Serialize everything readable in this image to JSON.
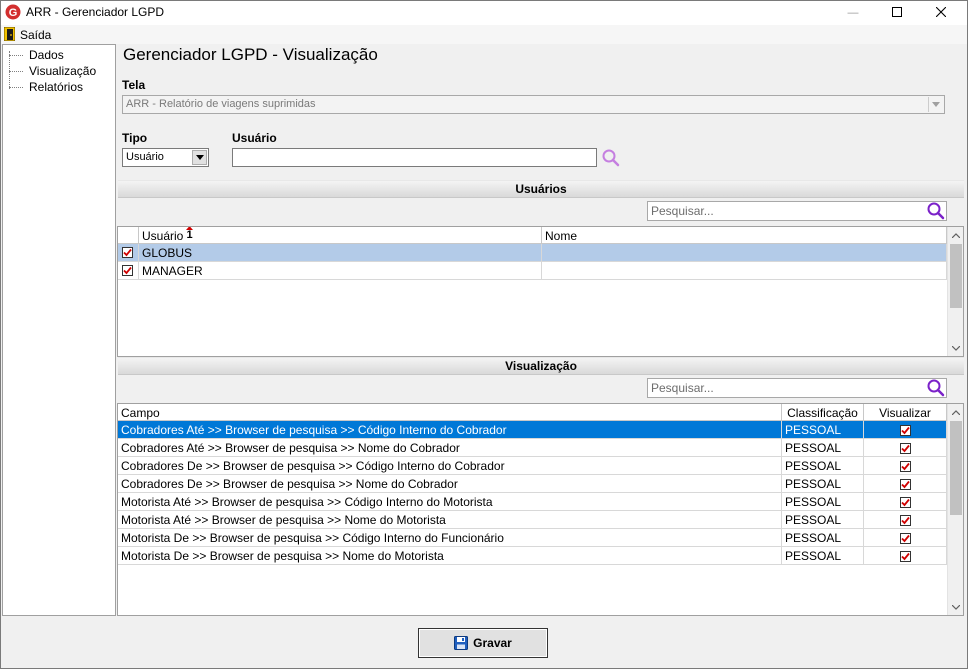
{
  "window": {
    "title": "ARR - Gerenciador LGPD",
    "logo_letter": "G",
    "minimize_glyph": "—",
    "maximize_glyph": "☐",
    "close_glyph": "✕"
  },
  "menu": {
    "exit_label": "Saída",
    "exit_icon": "door-exit-icon"
  },
  "tree": {
    "items": [
      {
        "label": "Dados"
      },
      {
        "label": "Visualização"
      },
      {
        "label": "Relatórios"
      }
    ]
  },
  "main": {
    "title": "Gerenciador LGPD - Visualização",
    "tela_label": "Tela",
    "tela_value": "ARR - Relatório de viagens suprimidas",
    "tipo_label": "Tipo",
    "tipo_value": "Usuário",
    "usuario_label": "Usuário",
    "usuario_value": ""
  },
  "users_section": {
    "title": "Usuários",
    "search_placeholder": "Pesquisar...",
    "columns": {
      "usuario": "Usuário",
      "sort_badge": "1",
      "nome": "Nome"
    },
    "rows": [
      {
        "checked": true,
        "usuario": "GLOBUS",
        "nome": "",
        "selected": true
      },
      {
        "checked": true,
        "usuario": "MANAGER",
        "nome": "",
        "selected": false
      }
    ]
  },
  "vis_section": {
    "title": "Visualização",
    "search_placeholder": "Pesquisar...",
    "columns": {
      "campo": "Campo",
      "classificacao": "Classificação",
      "visualizar": "Visualizar"
    },
    "rows": [
      {
        "campo": "Cobradores Até >> Browser de pesquisa >> Código Interno do Cobrador",
        "classificacao": "PESSOAL",
        "visualizar": true
      },
      {
        "campo": "Cobradores Até >> Browser de pesquisa >> Nome do Cobrador",
        "classificacao": "PESSOAL",
        "visualizar": true
      },
      {
        "campo": "Cobradores De >> Browser de pesquisa >> Código Interno do Cobrador",
        "classificacao": "PESSOAL",
        "visualizar": true
      },
      {
        "campo": "Cobradores De >> Browser de pesquisa >> Nome do Cobrador",
        "classificacao": "PESSOAL",
        "visualizar": true
      },
      {
        "campo": "Motorista Até >> Browser de pesquisa >> Código Interno do Motorista",
        "classificacao": "PESSOAL",
        "visualizar": true
      },
      {
        "campo": "Motorista Até >> Browser de pesquisa >> Nome do Motorista",
        "classificacao": "PESSOAL",
        "visualizar": true
      },
      {
        "campo": "Motorista De >> Browser de pesquisa >> Código Interno do Funcionário",
        "classificacao": "PESSOAL",
        "visualizar": true
      },
      {
        "campo": "Motorista De >> Browser de pesquisa >> Nome do Motorista",
        "classificacao": "PESSOAL",
        "visualizar": true
      }
    ]
  },
  "footer": {
    "save_label": "Gravar"
  },
  "colors": {
    "selection_blue": "#0078d7",
    "selection_light": "#b3cbe8",
    "search_purple": "#8a2be2",
    "check_red": "#d00000"
  }
}
